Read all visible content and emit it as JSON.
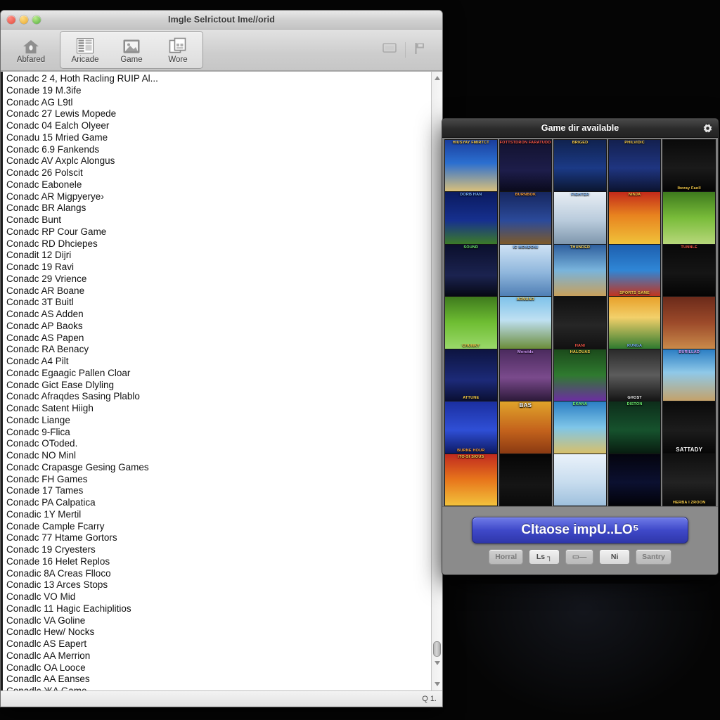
{
  "desktop": {
    "background_color": "#050505"
  },
  "mac_window": {
    "title": "Imgle Selrictout Ime//orid",
    "traffic_lights": [
      {
        "name": "close",
        "color": "#e24b3c"
      },
      {
        "name": "minimize",
        "color": "#e8a72c"
      },
      {
        "name": "zoom",
        "color": "#52ae3b"
      }
    ],
    "toolbar": {
      "home_label": "Abfared",
      "home_icon": "home-icon",
      "group": [
        {
          "label": "Aricade",
          "icon": "list-columns-icon"
        },
        {
          "label": "Game",
          "icon": "image-icon"
        },
        {
          "label": "Wore",
          "icon": "copy-windows-icon"
        }
      ],
      "right_icons": [
        {
          "name": "display-icon"
        },
        {
          "name": "flag-icon"
        }
      ]
    },
    "list": {
      "rows": [
        "Conadc 2 4, Hoth Racling RUIP Al...",
        "Conade 19 M.3ife",
        "Conadc AG L9tl",
        "Conadc 27 Lewis Mopede",
        "Conadc 04 Ealch Olyeer",
        "Conadu 15 Mried Game",
        "Conadc 6.9 Fankends",
        "Conadc AV Axplc Alongus",
        "Conadc 26 Polscit",
        "Conadc Eabonele",
        "Conadc AR Migpyerye›",
        "Conadc BR Alangs",
        "Conadc Bunt",
        "Conadc RP Cour Game",
        "Conadc RD Dhciepes",
        "Conadit 12 Dijri",
        "Conadc 19 Ravi",
        "Conadc 29 Vrience",
        "Conadc AR Boane",
        "Conadc 3T Buitl",
        "Conadc AS Adden",
        "Conadc AP Baoks",
        "Conadc AS Papen",
        "Conadc RA Benacy",
        "Conadc A4 Pilt",
        "Conadc Egaagic Pallen Cloar",
        "Conadc Gict Ease Dlyling",
        "Conadc Afraqdes Sasing Plablo",
        "Conadc Satent Hiigh",
        "Conadc Liange",
        "Conadc 9-Flica",
        "Conadc OToded.",
        "Conadc NO Minl",
        "Conadc Crapasge Gesing Games",
        "Conadc FH Games",
        "Conade 17 Tames",
        "Conadc PA Calpatica",
        "Conadic 1Y Mertil",
        "Conade Cample Fcarry",
        "Conadc 77 Htame Gortors",
        "Conadc 19 Cryesters",
        "Conade 16 Helet Replos",
        "Conadic 8A Creas Flloco",
        "Conadic 13 Arces Stops",
        "Conadlc VO Mid",
        "Conadlc 11 Hagic Eachiplitios",
        "Conadlc VA Goline",
        "Conadlc Hew/ Nocks",
        "Conadlc AS Eapert",
        "Conadlc AA Merrion",
        "Conadlc OA Looce",
        "Conadlc AA Eanses",
        "Conadlc ЖA Game"
      ]
    },
    "scrollbar": {
      "up_arrow": "▲",
      "down_arrow": "▼"
    },
    "statusbar": {
      "text": "Q 1."
    }
  },
  "game_window": {
    "title": "Game dir available",
    "gear_icon": "gear-icon",
    "grid": {
      "columns": 5,
      "rows": 7,
      "selected_index": 31,
      "cells": [
        {
          "cap": "HIUSYAY FMIRTCT",
          "capclass": "y top",
          "bg": "linear-gradient(#1a3d9c,#2b6fd0 45%,#d9c07a)"
        },
        {
          "cap": "DORB HAN",
          "capclass": "b top",
          "bg": "linear-gradient(#0a1a5e,#16308f 55%,#3b7a28)"
        },
        {
          "cap": "SOUND",
          "capclass": "g top",
          "bg": "linear-gradient(#0b0f2c,#1b2350 60%,#060814)"
        },
        {
          "cap": "CHUNKY",
          "capclass": "y",
          "bg": "linear-gradient(#3e7a1d,#6fbe33 50%,#9ad86a)"
        },
        {
          "cap": "ATTUNE",
          "capclass": "y",
          "bg": "linear-gradient(#0d1440,#1c2a78 60%,#0a0f33)"
        },
        {
          "cap": "BURNE HOUR",
          "capclass": "o",
          "bg": "linear-gradient(#1b2fa0,#2f4fd6 55%,#0d1a63)"
        },
        {
          "cap": "ITO-SI SIOUS",
          "capclass": "y top",
          "bg": "linear-gradient(#c02a1f,#e8761b 50%,#f2c23c)"
        },
        {
          "cap": "FOTTSTDRON FARATUDDLE",
          "capclass": "r top",
          "bg": "linear-gradient(#12122e,#1d1d4a 60%,#0a0a1c)"
        },
        {
          "cap": "BURNBOK",
          "capclass": "o top",
          "bg": "linear-gradient(#16265e,#2b4a9a 55%,#7d5a2a)"
        },
        {
          "cap": "IC MONDONI",
          "capclass": "b top",
          "bg": "linear-gradient(#cfe3f5,#8fb6dc 55%,#4f7fb5)"
        },
        {
          "cap": "ARNUAR",
          "capclass": "y top",
          "bg": "linear-gradient(#7ec2ea,#bfe0f2 45%,#6b8c3a)"
        },
        {
          "cap": "Moroids",
          "capclass": "p top",
          "bg": "linear-gradient(#4b2b5e,#7a4a8c 55%,#2d1a3a)"
        },
        {
          "cap": "BAS",
          "capclass": "big top",
          "bg": "linear-gradient(#e0a32a,#c4631c 55%,#8a3a12)"
        },
        {
          "cap": "",
          "capclass": "",
          "bg": "linear-gradient(#050505,#151515 60%,#0a0a0a)",
          "selected": true
        },
        {
          "cap": "BRIGED",
          "capclass": "y top",
          "bg": "linear-gradient(#10224f,#1b3a86 55%,#0b1630)"
        },
        {
          "cap": "FIGHTER",
          "capclass": "b top",
          "bg": "linear-gradient(#e8eef4,#b9cbdc 55%,#7f97ad)"
        },
        {
          "cap": "THUNDER",
          "capclass": "y top",
          "bg": "linear-gradient(#2e5f9e,#79b4dc 50%,#c8a05a)"
        },
        {
          "cap": "HANI",
          "capclass": "r",
          "bg": "linear-gradient(#101010,#262626 55%,#111)"
        },
        {
          "cap": "HALOUAS",
          "capclass": "y top",
          "bg": "linear-gradient(#1b4a1b,#2f7a2f 50%,#6b2fa0)"
        },
        {
          "cap": "EKANA",
          "capclass": "g top",
          "bg": "linear-gradient(#2b7ec4,#7fc6e8 50%,#d8c06a)"
        },
        {
          "cap": "",
          "capclass": "",
          "bg": "linear-gradient(#eaf2fa,#c7dcee 55%,#9fc0dd)"
        },
        {
          "cap": "PHILVIDIC",
          "capclass": "y top",
          "bg": "linear-gradient(#13204f,#1f3580 55%,#0c1430)"
        },
        {
          "cap": "NINJA",
          "capclass": "y top",
          "bg": "linear-gradient(#c22a1a,#e8831f 45%,#f0c23a)"
        },
        {
          "cap": "SPORTS GAME",
          "capclass": "y",
          "bg": "linear-gradient(#1d5fae,#2f86d6 50%,#c2341f)"
        },
        {
          "cap": "RUNGA",
          "capclass": "b",
          "bg": "linear-gradient(#e8a02a,#f2d06a 40%,#2f7a2f)"
        },
        {
          "cap": "GHOST",
          "capclass": "",
          "bg": "linear-gradient(#2a2a2a,#5c5c5c 50%,#151515)"
        },
        {
          "cap": "DISTON",
          "capclass": "g top",
          "bg": "linear-gradient(#0d2d1a,#16522d 55%,#081c10)"
        },
        {
          "cap": "",
          "capclass": "",
          "bg": "linear-gradient(#04040e,#0b1030 55%,#020208)"
        },
        {
          "cap": "Iboray Faoll",
          "capclass": "y",
          "bg": "linear-gradient(#0a0a0a,#1a1a1a 55%,#050505)"
        },
        {
          "cap": "",
          "capclass": "",
          "bg": "linear-gradient(#3e7a1d,#79bc3a 50%,#b7d77a)"
        },
        {
          "cap": "TUNNLE",
          "capclass": "top r",
          "bg": "linear-gradient(#090909,#151515 55%,#040404)"
        },
        {
          "cap": "",
          "capclass": "",
          "bg": "linear-gradient(#6b2a1a,#9c4a2a 50%,#c98a4a)"
        },
        {
          "cap": "BURILLAD",
          "capclass": "p top",
          "bg": "linear-gradient(#2b7ec4,#8fc9e8 45%,#c4a26a)"
        },
        {
          "cap": "SATTADY",
          "capclass": "big",
          "bg": "linear-gradient(#0a0a0a,#1c1c1c 55%,#060606)"
        },
        {
          "cap": "HERBA I ZROON",
          "capclass": "y",
          "bg": "linear-gradient(#0f0f0f,#222 55%,#0a0a0a)"
        }
      ]
    },
    "actions": {
      "primary_label": "Cltaose impU..LO⁵",
      "mini_buttons": [
        {
          "label": "Horral",
          "dim": true
        },
        {
          "label": "Ls ┐",
          "dim": false
        },
        {
          "label": "▭—",
          "dim": true,
          "icon": "rect-icon"
        },
        {
          "label": "Ni",
          "dim": false
        },
        {
          "label": "Santry",
          "dim": true
        }
      ]
    }
  }
}
